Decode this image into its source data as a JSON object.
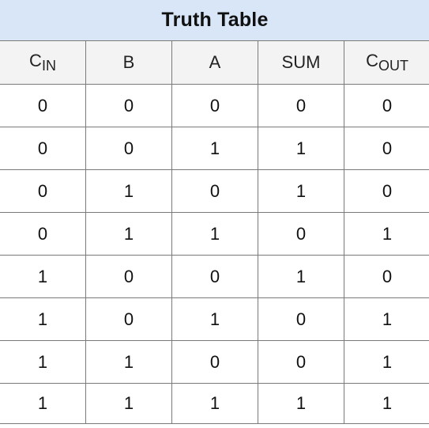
{
  "table": {
    "title": "Truth Table",
    "headers": [
      {
        "main": "C",
        "sub": "IN"
      },
      {
        "main": "B",
        "sub": ""
      },
      {
        "main": "A",
        "sub": ""
      },
      {
        "main": "SUM",
        "sub": ""
      },
      {
        "main": "C",
        "sub": "OUT"
      }
    ],
    "rows": [
      [
        "0",
        "0",
        "0",
        "0",
        "0"
      ],
      [
        "0",
        "0",
        "1",
        "1",
        "0"
      ],
      [
        "0",
        "1",
        "0",
        "1",
        "0"
      ],
      [
        "0",
        "1",
        "1",
        "0",
        "1"
      ],
      [
        "1",
        "0",
        "0",
        "1",
        "0"
      ],
      [
        "1",
        "0",
        "1",
        "0",
        "1"
      ],
      [
        "1",
        "1",
        "0",
        "0",
        "1"
      ],
      [
        "1",
        "1",
        "1",
        "1",
        "1"
      ]
    ]
  }
}
